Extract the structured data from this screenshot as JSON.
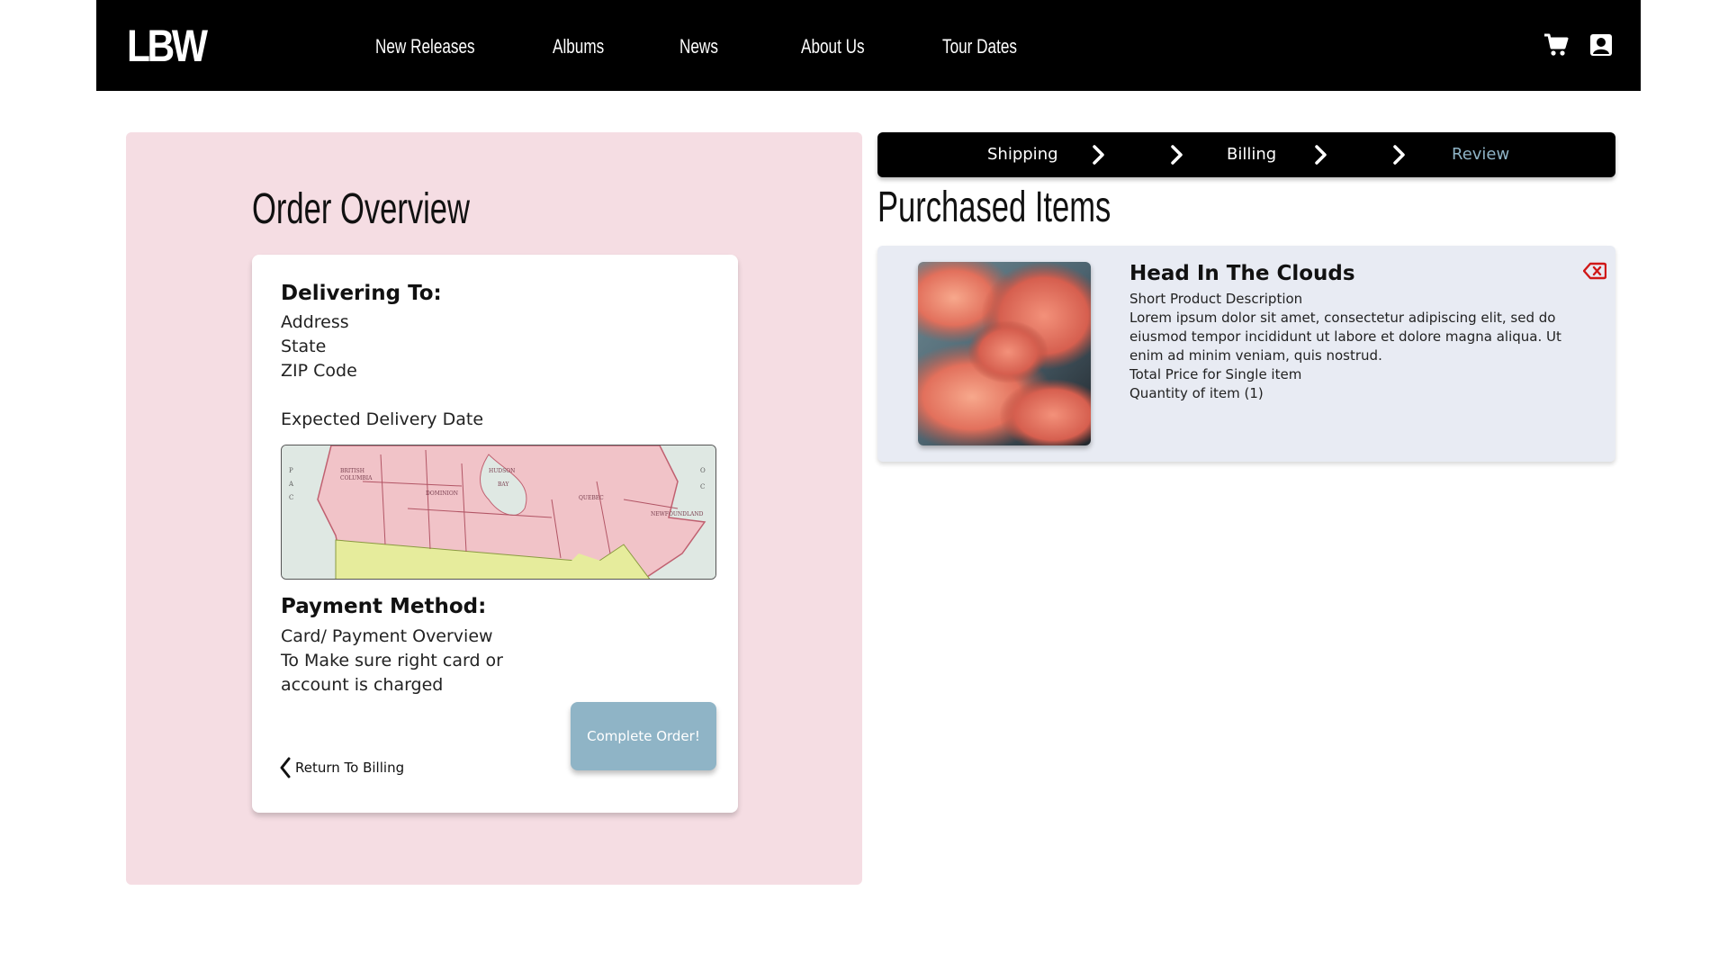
{
  "header": {
    "logo": "LBW",
    "nav": [
      "New Releases",
      "Albums",
      "News",
      "About Us",
      "Tour Dates"
    ],
    "icons": [
      "cart-icon",
      "account-icon"
    ]
  },
  "order": {
    "title": "Order Overview",
    "delivering_heading": "Delivering To:",
    "address_lines": [
      "Address",
      "State",
      "ZIP Code"
    ],
    "expected_delivery": "Expected Delivery Date",
    "payment_heading": "Payment Method:",
    "payment_lines": [
      "Card/ Payment Overview",
      "To Make sure right card or",
      "account is charged"
    ],
    "complete_button": "Complete Order!",
    "return_link": "Return To Billing"
  },
  "checkout_steps": {
    "steps": [
      "Shipping",
      "Billing",
      "Review"
    ],
    "active": "Review"
  },
  "purchased": {
    "title": "Purchased Items",
    "items": [
      {
        "name": "Head In The Clouds",
        "short_description": "Short Product Description",
        "description": "Lorem ipsum dolor sit amet, consectetur adipiscing elit, sed do eiusmod tempor incididunt ut labore et dolore magna aliqua. Ut enim ad minim veniam, quis nostrud.",
        "price_label": "Total Price for Single item",
        "quantity_label": "Quantity of item (1)"
      }
    ]
  },
  "colors": {
    "header_bg": "#000000",
    "left_panel_bg": "#f5dde3",
    "item_card_bg": "#e8ebf3",
    "accent": "#8fb4c6",
    "remove_icon": "#d01818"
  }
}
